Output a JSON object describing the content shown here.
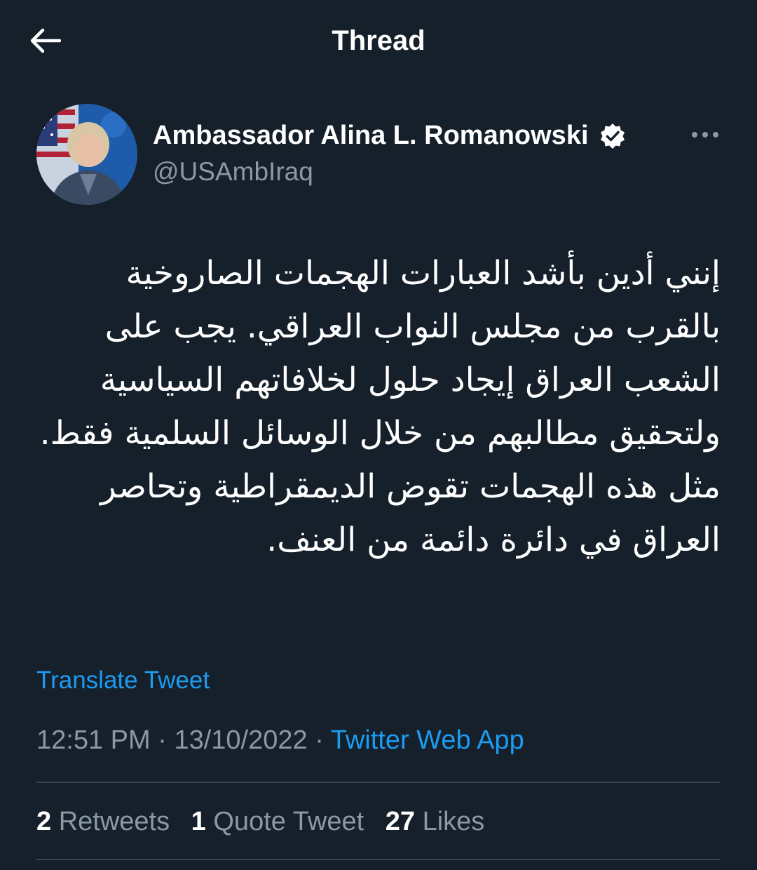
{
  "header": {
    "title": "Thread",
    "back_icon": "arrow-left-icon"
  },
  "tweet": {
    "author": {
      "name": "Ambassador Alina L. Romanowski",
      "handle": "@USAmbIraq",
      "verified": true,
      "verified_icon": "verified-badge-icon"
    },
    "more_icon": "more-options-icon",
    "text": "إنني أدين بأشد العبارات الهجمات الصاروخية بالقرب من مجلس النواب العراقي. يجب على الشعب العراق إيجاد حلول لخلافاتهم السياسية ولتحقيق مطالبهم من خلال الوسائل السلمية فقط. مثل هذه الهجمات تقوض الديمقراطية وتحاصر العراق في دائرة دائمة من العنف.",
    "translate_label": "Translate Tweet",
    "time": "12:51 PM",
    "separator": "·",
    "date": "13/10/2022",
    "source": "Twitter Web App"
  },
  "stats": {
    "retweets": {
      "count": "2",
      "label": "Retweets"
    },
    "quotes": {
      "count": "1",
      "label": "Quote Tweet"
    },
    "likes": {
      "count": "27",
      "label": "Likes"
    }
  },
  "colors": {
    "background": "#15202b",
    "accent": "#1d9bf0",
    "secondary_text": "#8b98a5",
    "divider": "#38444d"
  }
}
